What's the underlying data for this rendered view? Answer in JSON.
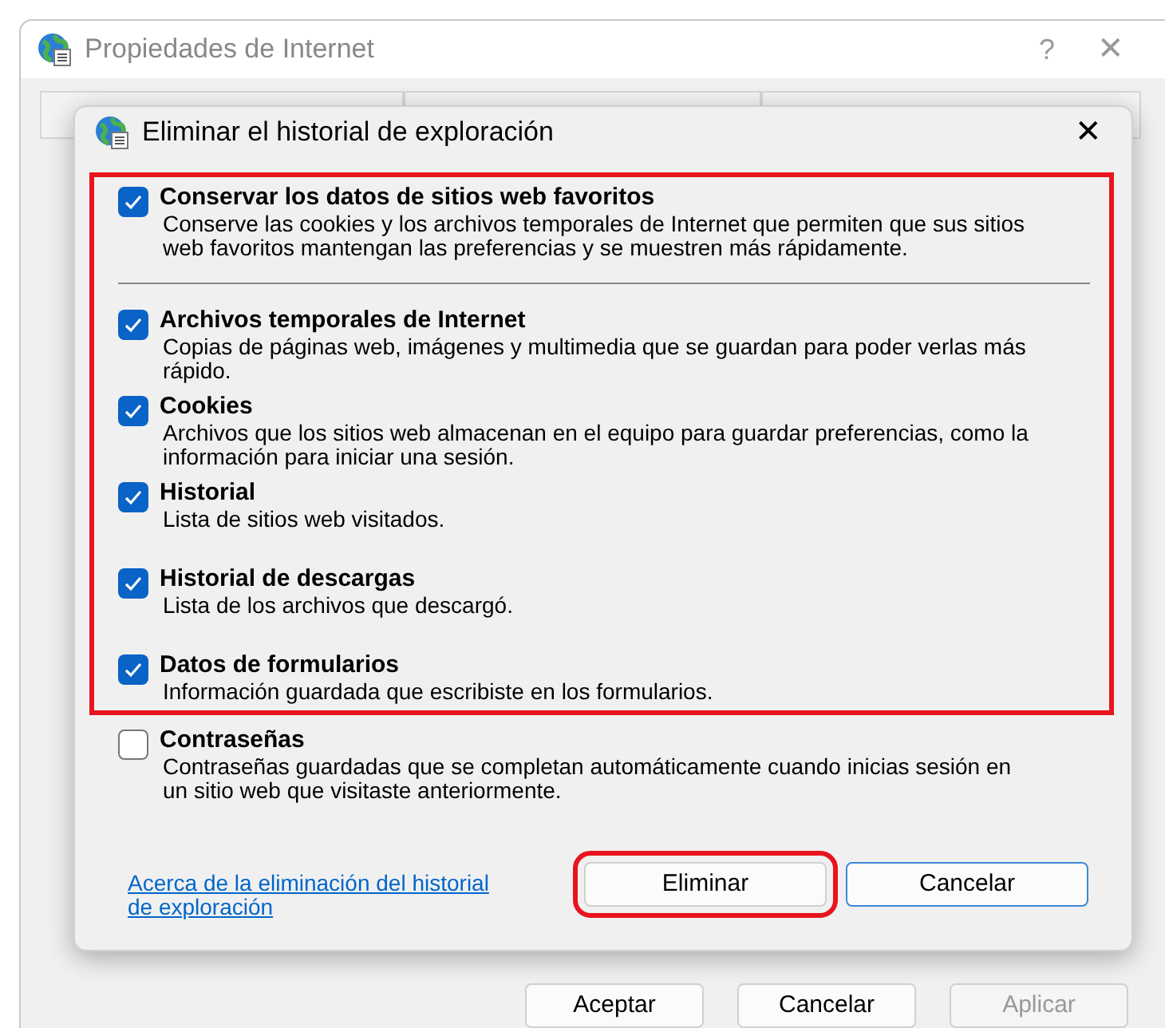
{
  "window": {
    "title": "Propiedades de Internet",
    "help": "?",
    "close": "✕"
  },
  "dialog": {
    "title": "Eliminar el historial de exploración",
    "close": "✕",
    "groups": [
      {
        "highlighted": true,
        "items": [
          {
            "kind": "option",
            "label": "Conservar los datos de sitios web favoritos",
            "description": "Conserve las cookies y los archivos temporales de Internet que permiten que sus sitios web favoritos mantengan las preferencias y se muestren más rápidamente.",
            "checked": true
          },
          {
            "kind": "separator"
          },
          {
            "kind": "option",
            "label": "Archivos temporales de Internet",
            "description": "Copias de páginas web, imágenes y multimedia que se guardan para poder verlas más rápido.",
            "checked": true
          },
          {
            "kind": "option",
            "label": "Cookies",
            "description": "Archivos que los sitios web almacenan en el equipo para guardar preferencias, como la información para iniciar una sesión.",
            "checked": true
          },
          {
            "kind": "option",
            "label": "Historial",
            "description": "Lista de sitios web visitados.",
            "checked": true
          },
          {
            "kind": "option",
            "label": "Historial de descargas",
            "description": "Lista de los archivos que descargó.",
            "checked": true
          },
          {
            "kind": "option",
            "label": "Datos de formularios",
            "description": "Información guardada que escribiste en los formularios.",
            "checked": true
          }
        ]
      },
      {
        "highlighted": false,
        "items": [
          {
            "kind": "option",
            "label": "Contraseñas",
            "description": "Contraseñas guardadas que se completan automáticamente cuando inicias sesión en un sitio web que visitaste anteriormente.",
            "checked": false
          }
        ]
      }
    ],
    "link": "Acerca de la eliminación del historial de exploración",
    "buttons": [
      {
        "label": "Eliminar",
        "highlighted": true
      },
      {
        "label": "Cancelar",
        "highlighted": false
      }
    ]
  },
  "buttons": [
    {
      "label": "Aceptar",
      "disabled": false
    },
    {
      "label": "Cancelar",
      "disabled": false
    },
    {
      "label": "Aplicar",
      "disabled": true
    }
  ]
}
